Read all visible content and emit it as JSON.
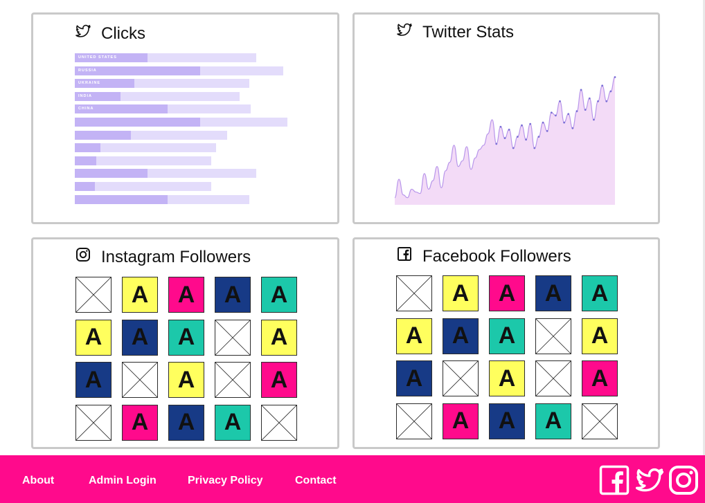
{
  "cards": {
    "clicks": {
      "title": "Clicks",
      "icon": "twitter-icon",
      "countries": [
        "UNITED STATES",
        "RUSSIA",
        "UKRAINE",
        "INDIA",
        "CHINA"
      ],
      "bar_values": [
        {
          "value": 0.4,
          "total": 1.0
        },
        {
          "value": 0.69,
          "total": 1.15
        },
        {
          "value": 0.33,
          "total": 0.96
        },
        {
          "value": 0.25,
          "total": 0.91
        },
        {
          "value": 0.51,
          "total": 0.97
        },
        {
          "value": 0.69,
          "total": 1.17
        },
        {
          "value": 0.31,
          "total": 0.84
        },
        {
          "value": 0.14,
          "total": 0.78
        },
        {
          "value": 0.12,
          "total": 0.75
        },
        {
          "value": 0.4,
          "total": 1.0
        },
        {
          "value": 0.11,
          "total": 0.75
        },
        {
          "value": 0.51,
          "total": 0.96
        }
      ]
    },
    "twitter_stats": {
      "title": "Twitter Stats",
      "icon": "twitter-icon"
    },
    "instagram": {
      "title": "Instagram Followers",
      "icon": "instagram-icon"
    },
    "facebook": {
      "title": "Facebook Followers",
      "icon": "facebook-icon"
    }
  },
  "chart_data": {
    "type": "area",
    "title": "Twitter Stats",
    "y": [
      5,
      18,
      7,
      5,
      11,
      9,
      8,
      22,
      11,
      17,
      27,
      12,
      24,
      30,
      42,
      27,
      31,
      41,
      25,
      33,
      39,
      42,
      50,
      60,
      43,
      55,
      47,
      53,
      40,
      48,
      56,
      46,
      57,
      40,
      48,
      58,
      52,
      65,
      63,
      73,
      58,
      64,
      54,
      66,
      81,
      67,
      75,
      60,
      73,
      84,
      73,
      80,
      90
    ],
    "color_fill": "#f3dbf7",
    "color_line": "#b896ea",
    "grid": false
  },
  "tiles": {
    "letter": "A",
    "colors": {
      "yellow": "#ffff5e",
      "pink": "#ff0a8c",
      "navy": "#173a86",
      "teal": "#1cc8aa"
    },
    "instagram": [
      "x",
      "yellow",
      "pink",
      "navy",
      "teal",
      "yellow",
      "navy",
      "teal",
      "x",
      "yellow",
      "navy",
      "x",
      "yellow",
      "x",
      "pink",
      "x",
      "pink",
      "navy",
      "teal",
      "x"
    ],
    "facebook": [
      "x",
      "yellow",
      "pink",
      "navy",
      "teal",
      "yellow",
      "navy",
      "teal",
      "x",
      "yellow",
      "navy",
      "x",
      "yellow",
      "x",
      "pink",
      "x",
      "pink",
      "navy",
      "teal",
      "x"
    ]
  },
  "footer": {
    "background": "#ff0a8c",
    "links": [
      "About",
      "Admin Login",
      "Privacy Policy",
      "Contact"
    ],
    "social_icons": [
      "facebook-icon",
      "twitter-icon",
      "instagram-icon"
    ]
  }
}
